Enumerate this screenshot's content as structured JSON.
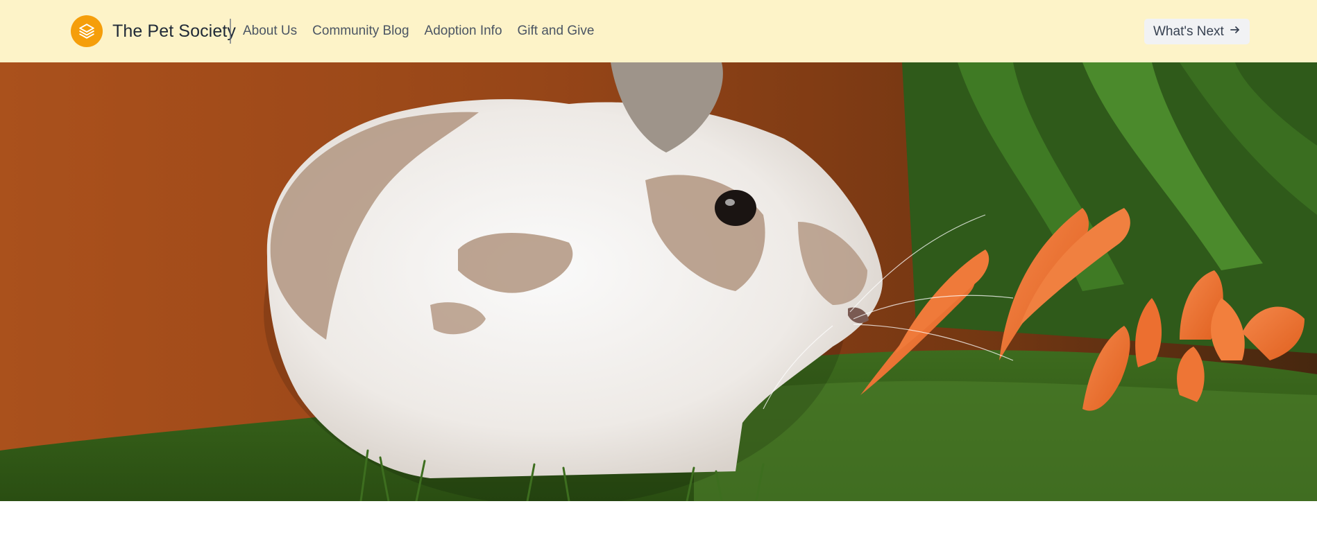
{
  "brand": {
    "name": "The Pet Society",
    "logo_icon": "stack-layers-icon",
    "logo_color": "#f59e0b"
  },
  "nav": {
    "items": [
      {
        "label": "About Us"
      },
      {
        "label": "Community Blog"
      },
      {
        "label": "Adoption Info"
      },
      {
        "label": "Gift and Give"
      }
    ]
  },
  "cta": {
    "label": "What's Next",
    "icon": "arrow-right-icon"
  },
  "hero": {
    "subject": "rabbit-with-carrots-photo"
  },
  "colors": {
    "header_bg": "#fdf3c8",
    "accent": "#f59e0b",
    "text_dark": "#1f2937",
    "text_nav": "#4b5563"
  }
}
